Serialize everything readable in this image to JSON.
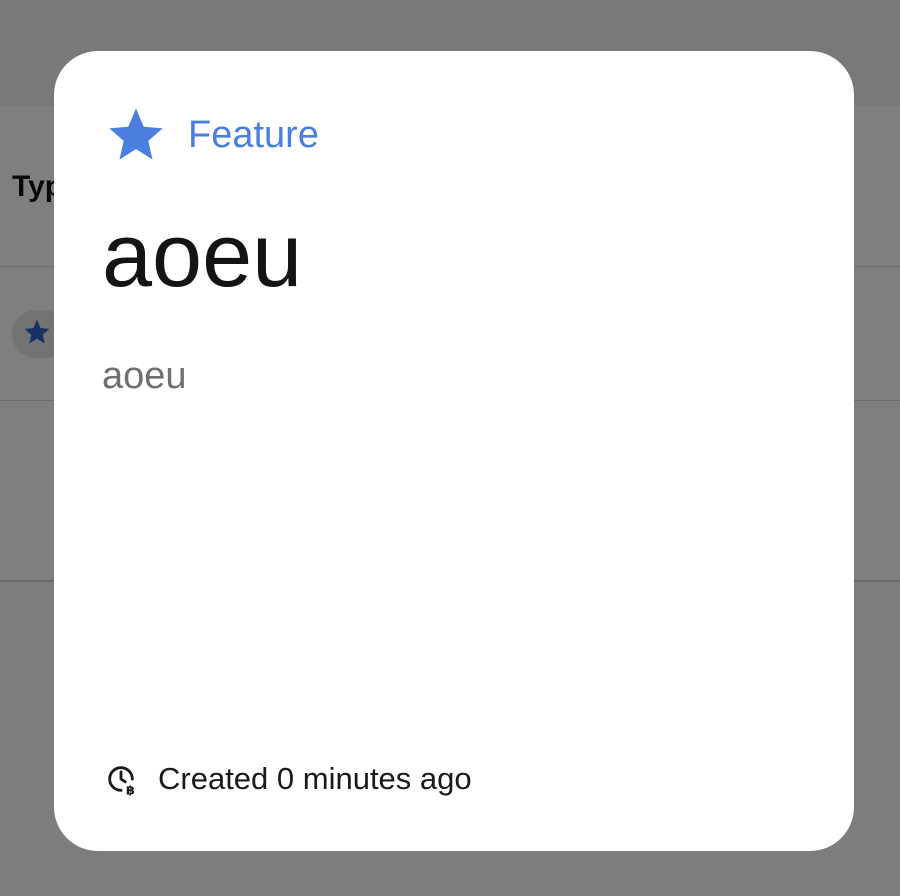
{
  "background": {
    "column_header": "Typ"
  },
  "dialog": {
    "type_icon": "star-icon",
    "type_label": "Feature",
    "title": "aoeu",
    "description": "aoeu",
    "footer_icon": "clock-icon",
    "created_text": "Created 0 minutes ago"
  },
  "colors": {
    "accent": "#4a7fe0",
    "scrim": "rgba(0,0,0,0.5)",
    "card": "#ffffff"
  }
}
